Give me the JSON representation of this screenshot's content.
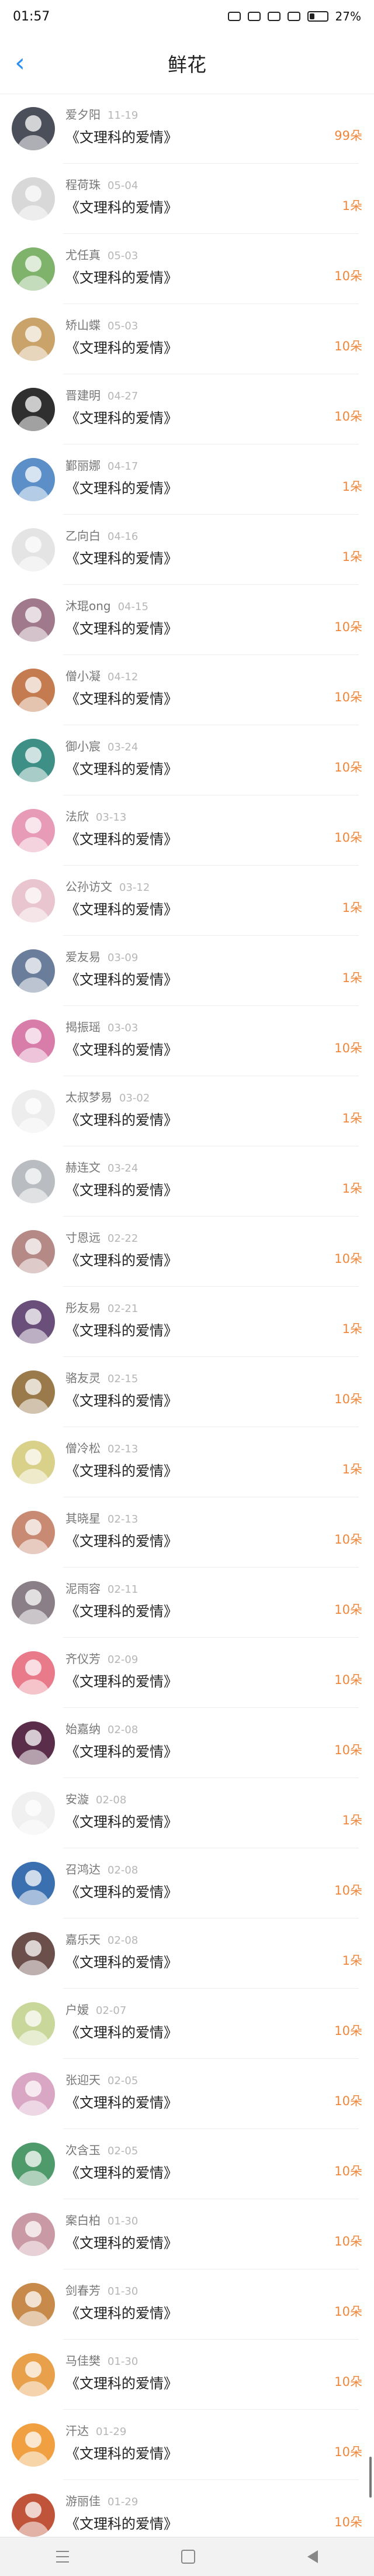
{
  "status": {
    "time": "01:57",
    "battery": "27%"
  },
  "header": {
    "title": "鲜花"
  },
  "unit": "朵",
  "items": [
    {
      "name": "爱夕阳",
      "date": "11-19",
      "book": "《文理科的爱情》",
      "count": "99朵",
      "color": "#4a4f5a"
    },
    {
      "name": "程荷珠",
      "date": "05-04",
      "book": "《文理科的爱情》",
      "count": "1朵",
      "color": "#d8d8d8"
    },
    {
      "name": "尤任真",
      "date": "05-03",
      "book": "《文理科的爱情》",
      "count": "10朵",
      "color": "#7fb26a"
    },
    {
      "name": "矫山蝶",
      "date": "05-03",
      "book": "《文理科的爱情》",
      "count": "10朵",
      "color": "#c9a36a"
    },
    {
      "name": "晋建明",
      "date": "04-27",
      "book": "《文理科的爱情》",
      "count": "10朵",
      "color": "#2f2f2f"
    },
    {
      "name": "鄞丽娜",
      "date": "04-17",
      "book": "《文理科的爱情》",
      "count": "1朵",
      "color": "#5c8fc8"
    },
    {
      "name": "乙向白",
      "date": "04-16",
      "book": "《文理科的爱情》",
      "count": "1朵",
      "color": "#e4e4e4"
    },
    {
      "name": "沐琨ong",
      "date": "04-15",
      "book": "《文理科的爱情》",
      "count": "10朵",
      "color": "#a07a8c"
    },
    {
      "name": "僧小凝",
      "date": "04-12",
      "book": "《文理科的爱情》",
      "count": "10朵",
      "color": "#c47b4f"
    },
    {
      "name": "御小宸",
      "date": "03-24",
      "book": "《文理科的爱情》",
      "count": "10朵",
      "color": "#3e8f86"
    },
    {
      "name": "法欣",
      "date": "03-13",
      "book": "《文理科的爱情》",
      "count": "10朵",
      "color": "#e79bb6"
    },
    {
      "name": "公孙访文",
      "date": "03-12",
      "book": "《文理科的爱情》",
      "count": "1朵",
      "color": "#e9c6cf"
    },
    {
      "name": "爱友易",
      "date": "03-09",
      "book": "《文理科的爱情》",
      "count": "1朵",
      "color": "#6a7d9a"
    },
    {
      "name": "揭振瑶",
      "date": "03-03",
      "book": "《文理科的爱情》",
      "count": "10朵",
      "color": "#d87caa"
    },
    {
      "name": "太叔梦易",
      "date": "03-02",
      "book": "《文理科的爱情》",
      "count": "1朵",
      "color": "#ededed"
    },
    {
      "name": "赫连文",
      "date": "03-24",
      "book": "《文理科的爱情》",
      "count": "1朵",
      "color": "#b9bcc0"
    },
    {
      "name": "寸恩远",
      "date": "02-22",
      "book": "《文理科的爱情》",
      "count": "10朵",
      "color": "#b58a86"
    },
    {
      "name": "彤友易",
      "date": "02-21",
      "book": "《文理科的爱情》",
      "count": "1朵",
      "color": "#6a4f7a"
    },
    {
      "name": "骆友灵",
      "date": "02-15",
      "book": "《文理科的爱情》",
      "count": "10朵",
      "color": "#9a7a4a"
    },
    {
      "name": "僧冷松",
      "date": "02-13",
      "book": "《文理科的爱情》",
      "count": "1朵",
      "color": "#d9d08a"
    },
    {
      "name": "其晓星",
      "date": "02-13",
      "book": "《文理科的爱情》",
      "count": "10朵",
      "color": "#c98a74"
    },
    {
      "name": "泥雨容",
      "date": "02-11",
      "book": "《文理科的爱情》",
      "count": "10朵",
      "color": "#8a7f86"
    },
    {
      "name": "齐仪芳",
      "date": "02-09",
      "book": "《文理科的爱情》",
      "count": "10朵",
      "color": "#e87a8a"
    },
    {
      "name": "始嘉纳",
      "date": "02-08",
      "book": "《文理科的爱情》",
      "count": "10朵",
      "color": "#5a2e4a"
    },
    {
      "name": "安漩",
      "date": "02-08",
      "book": "《文理科的爱情》",
      "count": "1朵",
      "color": "#f0f0f0"
    },
    {
      "name": "召鸿达",
      "date": "02-08",
      "book": "《文理科的爱情》",
      "count": "10朵",
      "color": "#3a6fb0"
    },
    {
      "name": "嘉乐天",
      "date": "02-08",
      "book": "《文理科的爱情》",
      "count": "1朵",
      "color": "#6b4f4a"
    },
    {
      "name": "户嫒",
      "date": "02-07",
      "book": "《文理科的爱情》",
      "count": "10朵",
      "color": "#c9d89a"
    },
    {
      "name": "张迎天",
      "date": "02-05",
      "book": "《文理科的爱情》",
      "count": "10朵",
      "color": "#d9a6c4"
    },
    {
      "name": "次含玉",
      "date": "02-05",
      "book": "《文理科的爱情》",
      "count": "10朵",
      "color": "#4f9a6a"
    },
    {
      "name": "案白柏",
      "date": "01-30",
      "book": "《文理科的爱情》",
      "count": "10朵",
      "color": "#c99aa6"
    },
    {
      "name": "剑春芳",
      "date": "01-30",
      "book": "《文理科的爱情》",
      "count": "10朵",
      "color": "#c88a4a"
    },
    {
      "name": "马佳樊",
      "date": "01-30",
      "book": "《文理科的爱情》",
      "count": "10朵",
      "color": "#e8a04a"
    },
    {
      "name": "汗达",
      "date": "01-29",
      "book": "《文理科的爱情》",
      "count": "10朵",
      "color": "#f0a040"
    },
    {
      "name": "游丽佳",
      "date": "01-29",
      "book": "《文理科的爱情》",
      "count": "10朵",
      "color": "#c0543a"
    }
  ]
}
